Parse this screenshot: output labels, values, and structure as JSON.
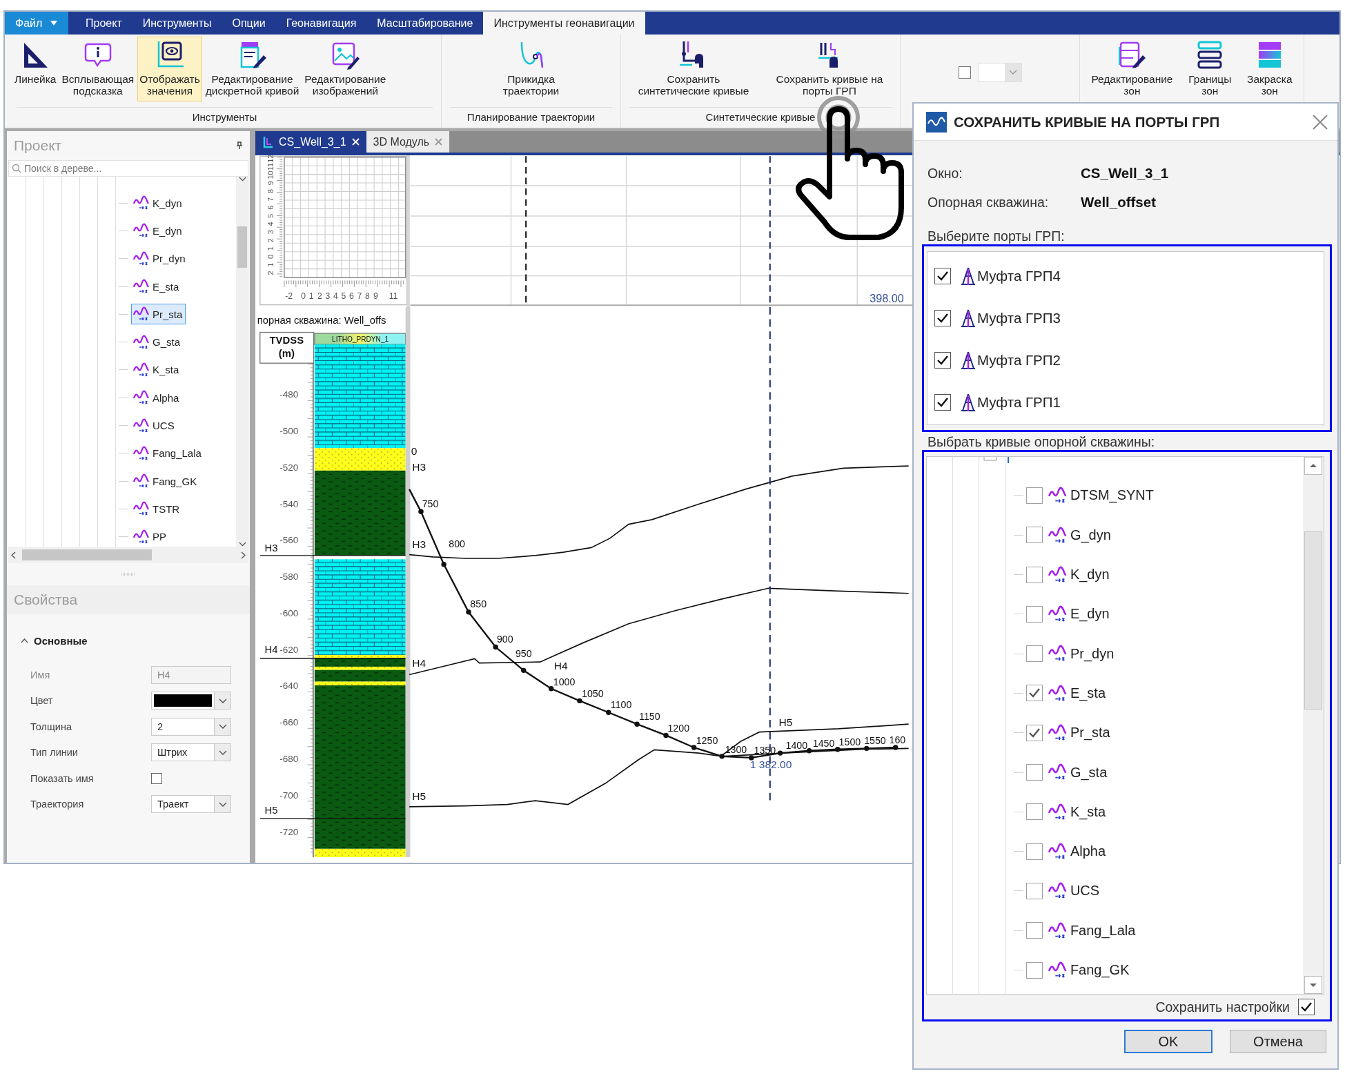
{
  "menu_tabs": [
    {
      "label": "Файл",
      "kind": "file",
      "selected": false
    },
    {
      "label": "Проект",
      "kind": "tab",
      "selected": false
    },
    {
      "label": "Инструменты",
      "kind": "tab",
      "selected": false
    },
    {
      "label": "Опции",
      "kind": "tab",
      "selected": false
    },
    {
      "label": "Геонавигация",
      "kind": "tab",
      "selected": false
    },
    {
      "label": "Масштабирование",
      "kind": "tab",
      "selected": false
    },
    {
      "label": "Инструменты геонавигации",
      "kind": "tab",
      "selected": true
    }
  ],
  "ribbon_groups": [
    {
      "kind": "buttons",
      "title": "Инструменты",
      "buttons": [
        {
          "label": "Линейка",
          "selected": false
        },
        {
          "label": "Всплывающая\nподсказка",
          "selected": false
        },
        {
          "label": "Отображать\nзначения",
          "selected": true
        },
        {
          "label": "Редактирование\nдискретной кривой",
          "selected": false
        },
        {
          "label": "Редактирование\nизображений",
          "selected": false
        }
      ]
    },
    {
      "kind": "buttons",
      "title": "Планирование траектории",
      "buttons": [
        {
          "label": "Прикидка\nтраектории",
          "selected": false
        }
      ]
    },
    {
      "kind": "buttons",
      "title": "Синтетические кривые",
      "buttons": [
        {
          "label": "Сохранить\nсинтетические кривые",
          "selected": false
        },
        {
          "label": "Сохранить кривые на\nпорты ГРП",
          "selected": false
        }
      ]
    },
    {
      "kind": "controls",
      "checked": false
    },
    {
      "kind": "buttons",
      "buttons": [
        {
          "label": "Редактирование\nзон",
          "selected": false
        },
        {
          "label": "Границы\nзон",
          "selected": false
        },
        {
          "label": "Закраска\nзон",
          "selected": false
        }
      ]
    }
  ],
  "project": {
    "title": "Проект",
    "search": {
      "placeholder": "Поиск в дереве..."
    },
    "items": [
      {
        "label": "K_dyn",
        "selected": false
      },
      {
        "label": "E_dyn",
        "selected": false
      },
      {
        "label": "Pr_dyn",
        "selected": false
      },
      {
        "label": "E_sta",
        "selected": false
      },
      {
        "label": "Pr_sta",
        "selected": true
      },
      {
        "label": "G_sta",
        "selected": false
      },
      {
        "label": "K_sta",
        "selected": false
      },
      {
        "label": "Alpha",
        "selected": false
      },
      {
        "label": "UCS",
        "selected": false
      },
      {
        "label": "Fang_Lala",
        "selected": false
      },
      {
        "label": "Fang_GK",
        "selected": false
      },
      {
        "label": "TSTR",
        "selected": false
      },
      {
        "label": "PP",
        "selected": false
      }
    ]
  },
  "properties": {
    "title": "Свойства",
    "section": {
      "label": "Основные",
      "expanded": true
    },
    "rows": [
      {
        "label": "Имя",
        "kind": "text",
        "value": "H4",
        "disabled": true
      },
      {
        "label": "Цвет",
        "kind": "color",
        "color": "#000000",
        "disabled": false
      },
      {
        "label": "Толщина",
        "kind": "combo",
        "value": "2",
        "disabled": false
      },
      {
        "label": "Тип линии",
        "kind": "combo",
        "value": "Штрих",
        "disabled": false
      },
      {
        "label": "Показать имя",
        "kind": "checkbox",
        "checked": false,
        "disabled": false
      },
      {
        "label": "Траектория",
        "kind": "combo",
        "value": "Траект",
        "disabled": false
      }
    ]
  },
  "view_tabs": [
    {
      "label": "CS_Well_3_1",
      "selected": true
    },
    {
      "label": "3D Модуль",
      "selected": false
    }
  ],
  "thumbnail": {
    "y_labels": [
      "2",
      "1",
      "0",
      "1",
      "2",
      "3",
      "4",
      "5",
      "6",
      "7",
      "8",
      "9",
      "10",
      "11",
      "12"
    ],
    "x_labels": [
      "-2",
      "0",
      "1",
      "2",
      "3",
      "4",
      "5",
      "6",
      "7",
      "8",
      "9",
      "11"
    ]
  },
  "upper_value": "398.00",
  "well_label": "порная скважина: Well_offs",
  "axis_title": [
    "TVDSS",
    "(m)"
  ],
  "log_name": "LITHO_PRDYN_1",
  "depth_ticks": [
    "-480",
    "-500",
    "-520",
    "-540",
    "-560",
    "-580",
    "-600",
    "-620",
    "-640",
    "-660",
    "-680",
    "-700",
    "-720"
  ],
  "well_horizons": [
    "H3",
    "H4",
    "H5"
  ],
  "section_labels": [
    "0",
    "H3",
    "H3",
    "H4",
    "H4",
    "H5",
    "H5"
  ],
  "trajectory_stations": [
    "750",
    "800",
    "850",
    "900",
    "950",
    "1000",
    "1050",
    "1100",
    "1150",
    "1200",
    "1250",
    "1300",
    "1350",
    "1400",
    "1450",
    "1500",
    "1550",
    "160"
  ],
  "cursor_value": "1 382.00",
  "dialog": {
    "title": "СОХРАНИТЬ КРИВЫЕ НА ПОРТЫ ГРП",
    "fields": [
      {
        "label": "Окно:",
        "value": "CS_Well_3_1"
      },
      {
        "label": "Опорная скважина:",
        "value": "Well_offset"
      }
    ],
    "ports_label": "Выберите порты ГРП:",
    "ports": [
      {
        "label": "Муфта ГРП4",
        "checked": true
      },
      {
        "label": "Муфта ГРП3",
        "checked": true
      },
      {
        "label": "Муфта ГРП2",
        "checked": true
      },
      {
        "label": "Муфта ГРП1",
        "checked": true
      }
    ],
    "curves_label": "Выбрать кривые опорной скважины:",
    "curves": [
      {
        "label": "DTSM_SYNT",
        "checked": false
      },
      {
        "label": "G_dyn",
        "checked": false
      },
      {
        "label": "K_dyn",
        "checked": false
      },
      {
        "label": "E_dyn",
        "checked": false
      },
      {
        "label": "Pr_dyn",
        "checked": false
      },
      {
        "label": "E_sta",
        "checked": true
      },
      {
        "label": "Pr_sta",
        "checked": true
      },
      {
        "label": "G_sta",
        "checked": false
      },
      {
        "label": "K_sta",
        "checked": false
      },
      {
        "label": "Alpha",
        "checked": false
      },
      {
        "label": "UCS",
        "checked": false
      },
      {
        "label": "Fang_Lala",
        "checked": false
      },
      {
        "label": "Fang_GK",
        "checked": false
      }
    ],
    "save_settings": {
      "label": "Сохранить настройки",
      "checked": true
    },
    "buttons": [
      {
        "label": "OK",
        "default": true
      },
      {
        "label": "Отмена",
        "default": false
      }
    ]
  }
}
